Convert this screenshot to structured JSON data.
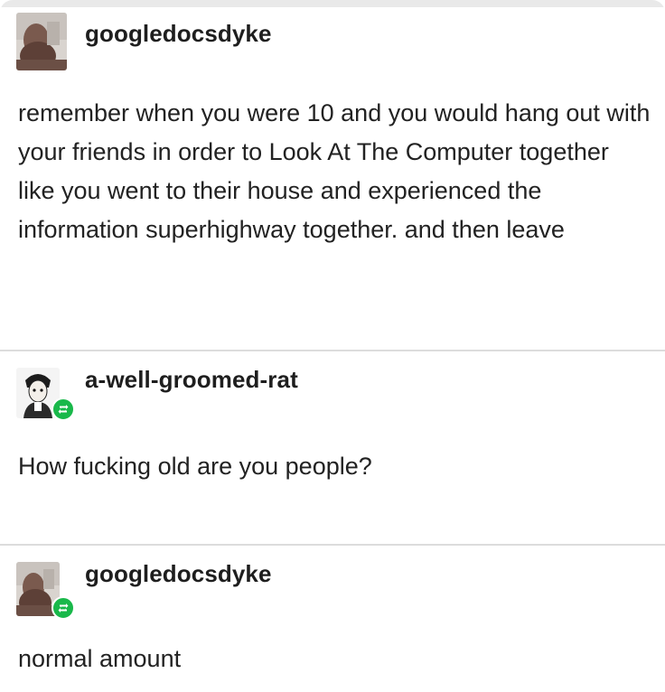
{
  "thread": {
    "posts": [
      {
        "username": "googledocsdyke",
        "text": "remember when you were 10 and you would hang out with your friends in order to Look At The Computer together like you went to their house and experienced the information superhighway together. and then leave",
        "reblog_badge": false
      },
      {
        "username": "a-well-groomed-rat",
        "text": "How fucking old are you people?",
        "reblog_badge": true
      },
      {
        "username": "googledocsdyke",
        "text": "normal amount",
        "reblog_badge": true
      }
    ]
  },
  "colors": {
    "reblog_badge": "#19b84a",
    "divider": "#dcdcdc",
    "text": "#222222"
  }
}
